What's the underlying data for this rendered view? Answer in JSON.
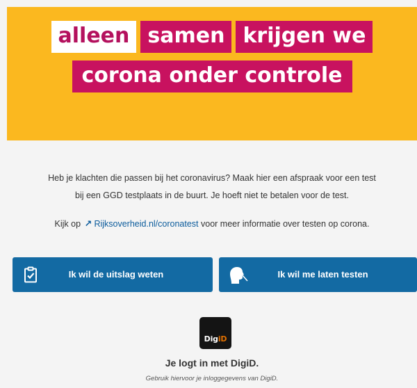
{
  "hero": {
    "line1": [
      "alleen",
      "samen",
      "krijgen we"
    ],
    "line2": "corona onder controle"
  },
  "intro": {
    "line1": "Heb je klachten die passen bij het coronavirus? Maak hier een afspraak voor een test",
    "line2": "bij een GGD testplaats in de buurt. Je hoeft niet te betalen voor de test."
  },
  "more_info": {
    "prefix": "Kijk op",
    "link": "Rijksoverheid.nl/coronatest",
    "suffix": "voor meer informatie over testen op corona."
  },
  "buttons": {
    "result": "Ik wil de uitslag weten",
    "test": "Ik wil me laten testen"
  },
  "digid": {
    "logo_prefix": "Dig",
    "logo_suffix": "iD",
    "title": "Je logt in met DigiD.",
    "subtitle": "Gebruik hiervoor je inloggegevens van DigiD."
  },
  "colors": {
    "hero_bg": "#fbb81f",
    "magenta": "#c8125f",
    "button_blue": "#136aa3",
    "link_blue": "#0c5c9c"
  },
  "icons": {
    "result_button": "clipboard-check-icon",
    "test_button": "head-profile-icon",
    "external_link": "external-arrow-icon"
  }
}
